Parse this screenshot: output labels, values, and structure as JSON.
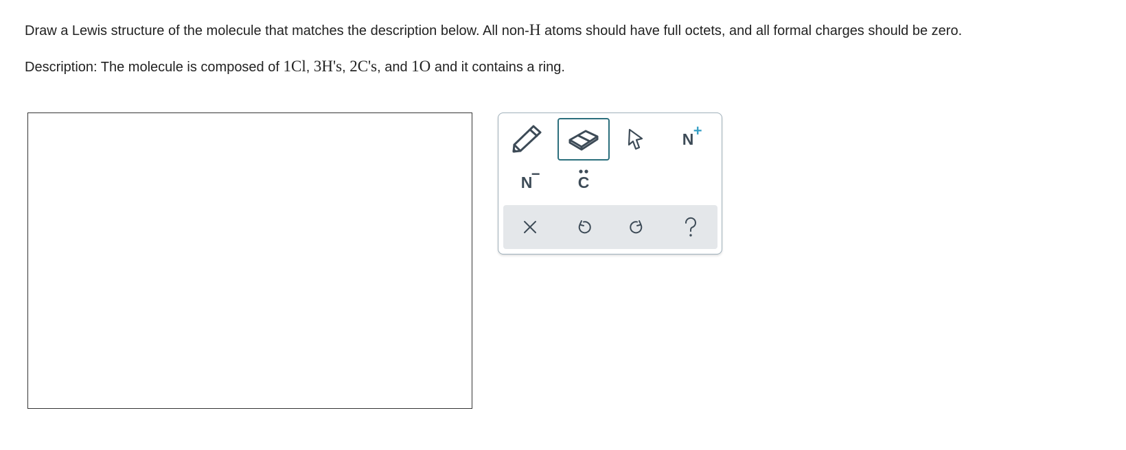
{
  "question": {
    "instruction_pre": "Draw a Lewis structure of the molecule that matches the description below. All non-",
    "instruction_symbol": "H",
    "instruction_post": " atoms should have full octets, and all formal charges should be zero.",
    "description_label": "Description: The molecule is composed of ",
    "cl_count": "1Cl",
    "sep1": ", ",
    "h_count": "3H's",
    "sep2": ", ",
    "c_count": "2C's",
    "sep3": ", and ",
    "o_count": "1O",
    "description_post": " and it contains a ring."
  },
  "toolbox": {
    "tools": [
      {
        "name": "pencil-tool",
        "icon": "pencil-icon",
        "selected": false
      },
      {
        "name": "eraser-tool",
        "icon": "eraser-icon",
        "selected": true
      },
      {
        "name": "select-tool",
        "icon": "cursor-arrow-icon",
        "selected": false
      },
      {
        "name": "positive-charge-tool",
        "icon": "positive-charge-icon",
        "label": "N",
        "sup": "+",
        "selected": false
      },
      {
        "name": "negative-charge-tool",
        "icon": "negative-charge-icon",
        "label": "N",
        "sup": "−",
        "selected": false
      },
      {
        "name": "lone-pair-tool",
        "icon": "lone-pair-icon",
        "label": "C",
        "selected": false
      }
    ],
    "footer": [
      {
        "name": "clear-button",
        "icon": "close-icon"
      },
      {
        "name": "undo-button",
        "icon": "undo-icon"
      },
      {
        "name": "redo-button",
        "icon": "redo-icon"
      },
      {
        "name": "help-button",
        "icon": "help-icon"
      }
    ]
  },
  "colors": {
    "icon": "#3d4b57",
    "accent_plus": "#3aa1c6",
    "selected_border": "#2a6e7c",
    "footer_bg": "#e4e7ea"
  }
}
